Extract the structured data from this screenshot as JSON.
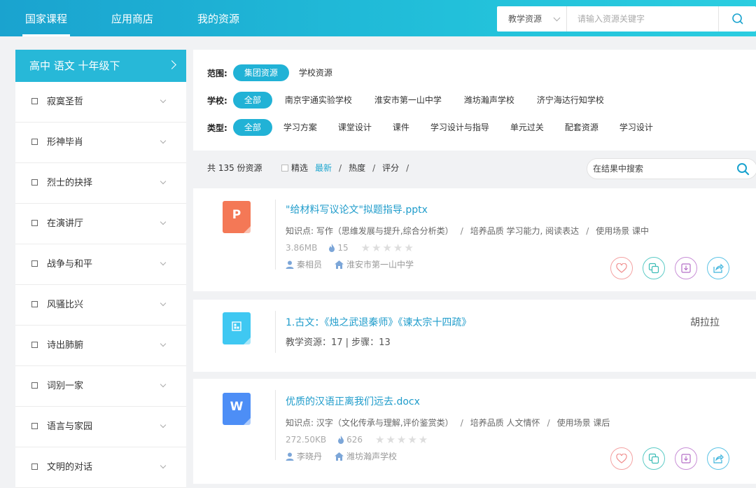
{
  "topnav": {
    "items": [
      {
        "label": "国家课程",
        "active": true
      },
      {
        "label": "应用商店",
        "active": false
      },
      {
        "label": "我的资源",
        "active": false
      }
    ],
    "search": {
      "category": "教学资源",
      "placeholder": "请输入资源关键字"
    }
  },
  "sidebar": {
    "header": "高中 语文 十年级下",
    "items": [
      {
        "label": "寂寞圣哲"
      },
      {
        "label": "形神毕肖"
      },
      {
        "label": "烈士的抉择"
      },
      {
        "label": "在演讲厅"
      },
      {
        "label": "战争与和平"
      },
      {
        "label": "风骚比兴"
      },
      {
        "label": "诗出肺腑"
      },
      {
        "label": "词别一家"
      },
      {
        "label": "语言与家园"
      },
      {
        "label": "文明的对话"
      }
    ]
  },
  "filters": {
    "scope": {
      "label": "范围:",
      "options": [
        "集团资源",
        "学校资源"
      ],
      "selected": 0
    },
    "school": {
      "label": "学校:",
      "options": [
        "全部",
        "南京宇通实验学校",
        "淮安市第一山中学",
        "潍坊瀚声学校",
        "济宁海达行知学校"
      ],
      "selected": 0
    },
    "type": {
      "label": "类型:",
      "options": [
        "全部",
        "学习方案",
        "课堂设计",
        "课件",
        "学习设计与指导",
        "单元过关",
        "配套资源",
        "学习设计"
      ],
      "selected": 0
    }
  },
  "sortbar": {
    "count_text": "共 135 份资源",
    "featured_label": "精选",
    "options": [
      "最新",
      "热度",
      "评分"
    ],
    "active": 0,
    "search_placeholder": "在结果中搜索"
  },
  "resources": [
    {
      "icon_letter": "P",
      "icon_color": "#f47856",
      "title": "\"给材料写议论文\"拟题指导.pptx",
      "knowledge": "知识点:  写作（思维发展与提升,综合分析类）",
      "quality": "培养品质 学习能力,  阅读表达",
      "scene": "使用场景 课中",
      "size": "3.86MB",
      "heat": "15",
      "author": "秦相员",
      "school": "淮安市第一山中学"
    },
    {
      "icon_letter": "",
      "icon_color": "#3fc8f2",
      "title": "1.古文：《烛之武退秦师》《谏太宗十四疏》",
      "stats": "教学资源：17  |  步骤：13",
      "owner": "胡拉拉"
    },
    {
      "icon_letter": "W",
      "icon_color": "#4d8ef6",
      "title": "优质的汉语正离我们远去.docx",
      "knowledge": "知识点:  汉字（文化传承与理解,评价鉴赏类）",
      "quality": "培养品质 人文情怀",
      "scene": "使用场景 课后",
      "size": "272.50KB",
      "heat": "626",
      "author": "李晓丹",
      "school": "潍坊瀚声学校"
    }
  ]
}
